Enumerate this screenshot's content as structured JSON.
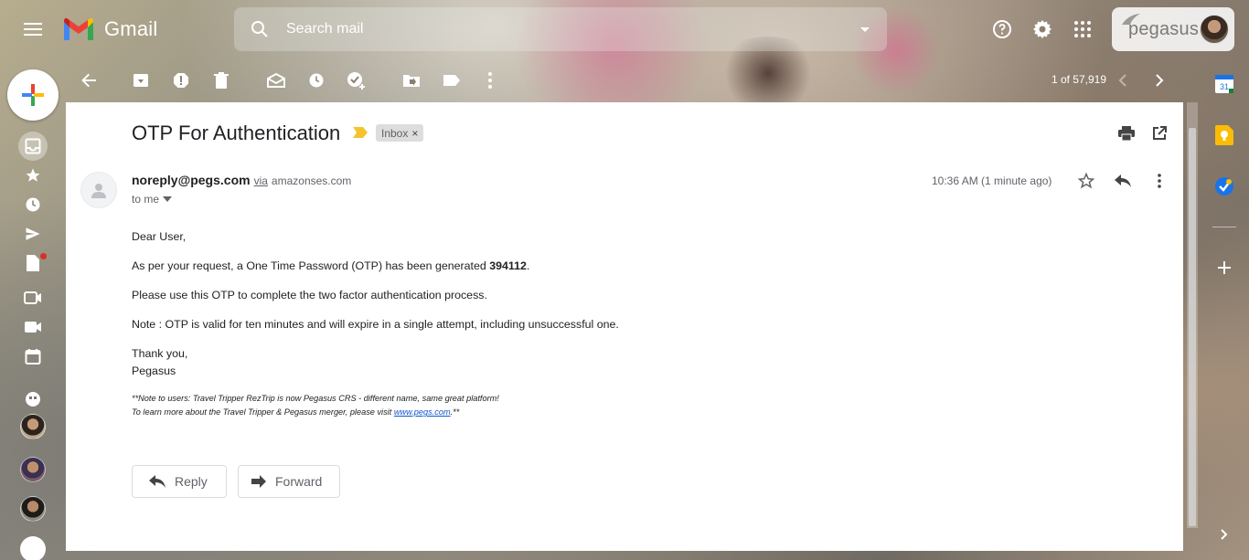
{
  "header": {
    "app_name": "Gmail",
    "search_placeholder": "Search mail",
    "account_logo_text": "pegasus"
  },
  "toolbar": {
    "pager": "1 of 57,919"
  },
  "message": {
    "subject": "OTP For Authentication",
    "label": "Inbox",
    "label_remove": "×",
    "sender_email": "noreply@pegs.com",
    "via_text": "via",
    "via_domain": "amazonses.com",
    "recipient": "to me",
    "timestamp": "10:36 AM (1 minute ago)",
    "greeting": "Dear User,",
    "line1_pre": "As per your request, a One Time Password (OTP) has been generated ",
    "otp": "394112",
    "line1_post": ".",
    "line2": "Please use this OTP to complete the two factor authentication process.",
    "line3": "Note : OTP is valid for ten minutes and will expire in a single attempt, including unsuccessful one.",
    "signoff": "Thank you,",
    "signature": "Pegasus",
    "note1": "**Note to users: Travel Tripper RezTrip is now Pegasus CRS - different name, same great platform!",
    "note2_pre": "To learn more about the Travel Tripper & Pegasus merger, please visit ",
    "note2_link": "www.pegs.com",
    "note2_post": ".**"
  },
  "actions": {
    "reply_label": "Reply",
    "forward_label": "Forward"
  },
  "side_panel": {
    "calendar_day": "31"
  },
  "colors": {
    "panel_bg": "#ffffff",
    "importance": "#f4c430",
    "link": "#1155cc",
    "calendar_blue": "#1a73e8",
    "keep_yellow": "#fbbc04"
  }
}
